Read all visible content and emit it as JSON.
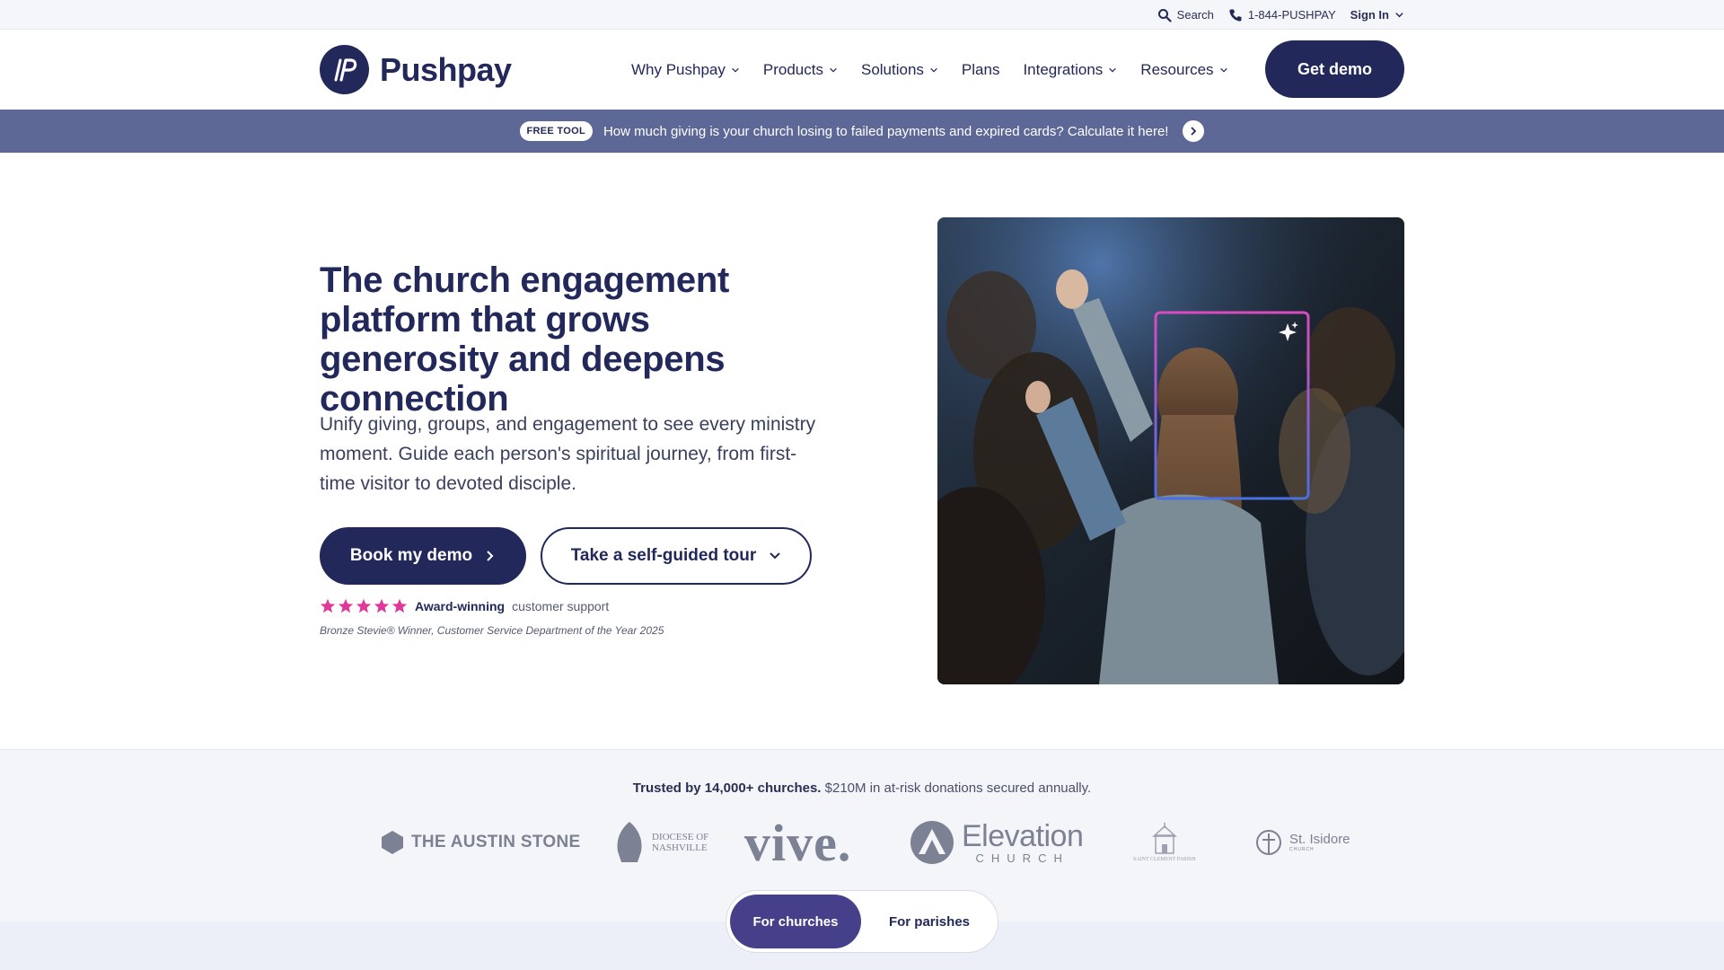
{
  "utility": {
    "search_label": "Search",
    "phone_label": "1-844-PUSHPAY",
    "signin_label": "Sign In"
  },
  "brand": {
    "name": "Pushpay",
    "color": "#22285a"
  },
  "nav": {
    "items": [
      {
        "label": "Why Pushpay",
        "has_dropdown": true
      },
      {
        "label": "Products",
        "has_dropdown": true
      },
      {
        "label": "Solutions",
        "has_dropdown": true
      },
      {
        "label": "Plans",
        "has_dropdown": false
      },
      {
        "label": "Integrations",
        "has_dropdown": true
      },
      {
        "label": "Resources",
        "has_dropdown": true
      }
    ],
    "cta_label": "Get demo"
  },
  "promo": {
    "badge": "FREE TOOL",
    "text": "How much giving is your church losing to failed payments and expired cards? Calculate it here!",
    "arrow_icon": "chevron-right-icon"
  },
  "hero": {
    "title": "The church engagement platform that grows generosity and deepens connection",
    "subtitle": "Unify giving, groups, and engagement to see every ministry moment. Guide each person's spiritual journey, from first-time visitor to devoted disciple.",
    "primary_cta": "Book my demo",
    "secondary_cta": "Take a self-guided tour",
    "rating": {
      "stars": 5,
      "strong": "Award-winning",
      "rest": "customer support",
      "star_color": "#e0389a"
    },
    "award_note": "Bronze Stevie® Winner, Customer Service Department of the Year 2025"
  },
  "trust": {
    "strong": "Trusted by 14,000+ churches.",
    "rest": "$210M in at-risk donations secured annually.",
    "logos": [
      {
        "name": "THE AUSTIN STONE"
      },
      {
        "line1": "DIOCESE OF",
        "line2": "NASHVILLE"
      },
      {
        "name": "vive."
      },
      {
        "name": "Elevation",
        "sub": "CHURCH"
      },
      {
        "name": "SAINT CLEMENT PARISH"
      },
      {
        "name": "St. Isidore",
        "sub": "CHURCH"
      }
    ]
  },
  "toggle": {
    "options": [
      {
        "label": "For churches",
        "active": true
      },
      {
        "label": "For parishes",
        "active": false
      }
    ],
    "active_color": "#46408a"
  }
}
